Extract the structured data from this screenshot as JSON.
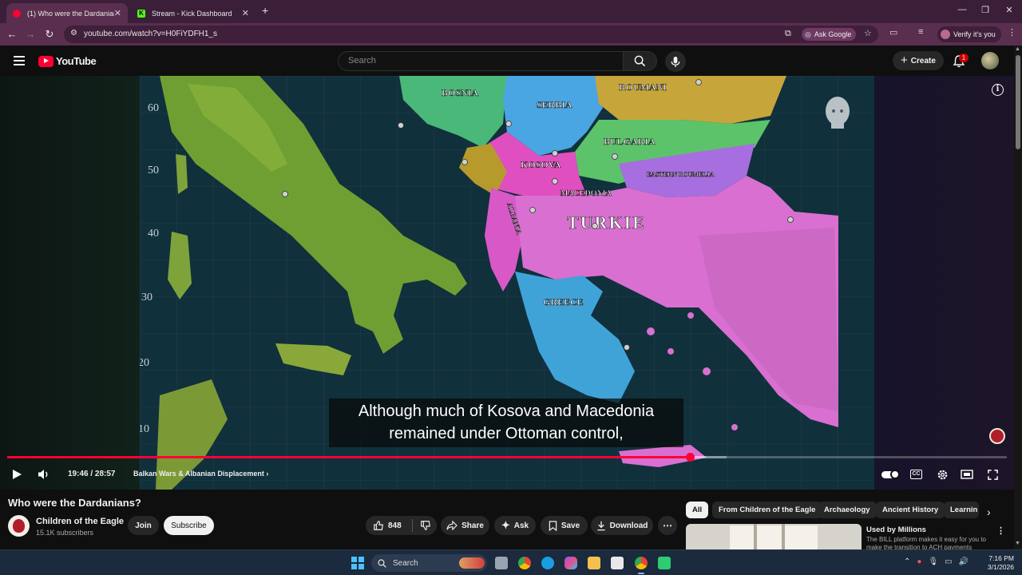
{
  "browser": {
    "tabs": [
      {
        "title": "(1) Who were the Dardanians?",
        "favicon": "youtube-favicon",
        "active": true
      },
      {
        "title": "Stream - Kick Dashboard",
        "favicon": "kick-favicon",
        "active": false
      }
    ],
    "new_tab_icon": "+",
    "url": "youtube.com/watch?v=H0FiYDFH1_s",
    "ask_google": "Ask Google",
    "verify_label": "Verify it's you",
    "accent": "#5a2e4f"
  },
  "youtube": {
    "logo_text": "YouTube",
    "search_placeholder": "Search",
    "create_label": "Create",
    "notification_count": "1"
  },
  "player": {
    "subtitle_line1": "Although much of Kosova and Macedonia",
    "subtitle_line2": "remained under Ottoman control,",
    "time": "19:46 / 28:57",
    "chapter": "Balkan Wars & Albanian Displacement",
    "played_fraction": 0.6829,
    "loaded_fraction": 0.72,
    "map": {
      "lat_labels": [
        "60",
        "50",
        "40",
        "30",
        "20",
        "10"
      ],
      "regions": [
        "BOSNIA",
        "SERBIA",
        "ROUMANI",
        "BULGARIA",
        "KOSOVA",
        "MACEDONIA",
        "EASTERN ROUMELIA",
        "ALBANIA",
        "TURKIE",
        "GREECE"
      ]
    }
  },
  "video": {
    "title": "Who were the Dardanians?",
    "channel": "Children of the Eagle",
    "subscribers": "15.1K subscribers",
    "join": "Join",
    "subscribe": "Subscribe",
    "likes": "848",
    "share": "Share",
    "ask": "Ask",
    "save": "Save",
    "download": "Download"
  },
  "chips": [
    "All",
    "From Children of the Eagle",
    "Archaeology",
    "Ancient History",
    "Learnin"
  ],
  "ad": {
    "title": "Used by Millions",
    "body": "The BILL platform makes it easy for you to make the transition to ACH payments"
  },
  "taskbar": {
    "search": "Search",
    "time": "7:16 PM",
    "date": "3/1/2026"
  }
}
